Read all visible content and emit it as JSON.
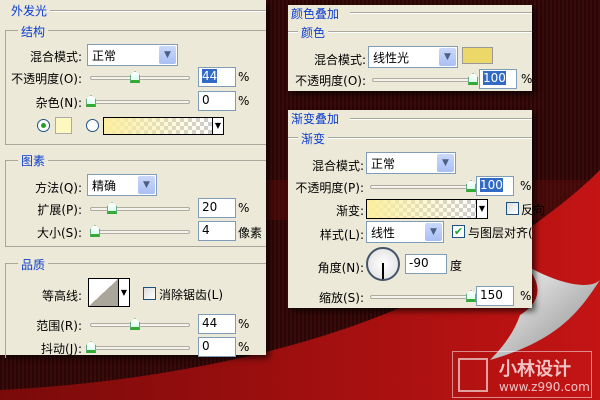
{
  "outer_glow": {
    "title": "外发光",
    "structure": {
      "title": "结构",
      "blend_label": "混合模式:",
      "blend_value": "正常",
      "opacity_label": "不透明度(O):",
      "opacity_value": "44",
      "noise_label": "杂色(N):",
      "noise_value": "0",
      "unit": "%",
      "color_swatch": "#fdf8c0"
    },
    "elements": {
      "title": "图素",
      "method_label": "方法(Q):",
      "method_value": "精确",
      "spread_label": "扩展(P):",
      "spread_value": "20",
      "size_label": "大小(S):",
      "size_value": "4",
      "size_unit": "像素",
      "unit": "%"
    },
    "quality": {
      "title": "品质",
      "contour_label": "等高线:",
      "antialias_label": "消除锯齿(L)",
      "range_label": "范围(R):",
      "range_value": "44",
      "jitter_label": "抖动(J):",
      "jitter_value": "0",
      "unit": "%"
    }
  },
  "color_overlay": {
    "title": "颜色叠加",
    "group": "颜色",
    "blend_label": "混合模式:",
    "blend_value": "线性光",
    "color": "#ecd868",
    "opacity_label": "不透明度(O):",
    "opacity_value": "100",
    "unit": "%"
  },
  "gradient_overlay": {
    "title": "渐变叠加",
    "group": "渐变",
    "blend_label": "混合模式:",
    "blend_value": "正常",
    "opacity_label": "不透明度(P):",
    "opacity_value": "100",
    "unit": "%",
    "gradient_label": "渐变:",
    "reverse_label": "反向",
    "style_label": "样式(L):",
    "style_value": "线性",
    "align_label": "与图层对齐(",
    "angle_label": "角度(N):",
    "angle_value": "-90",
    "angle_unit": "度",
    "scale_label": "缩放(S):",
    "scale_value": "150"
  },
  "watermark": {
    "name": "小林设计",
    "url": "www.z990.com"
  }
}
